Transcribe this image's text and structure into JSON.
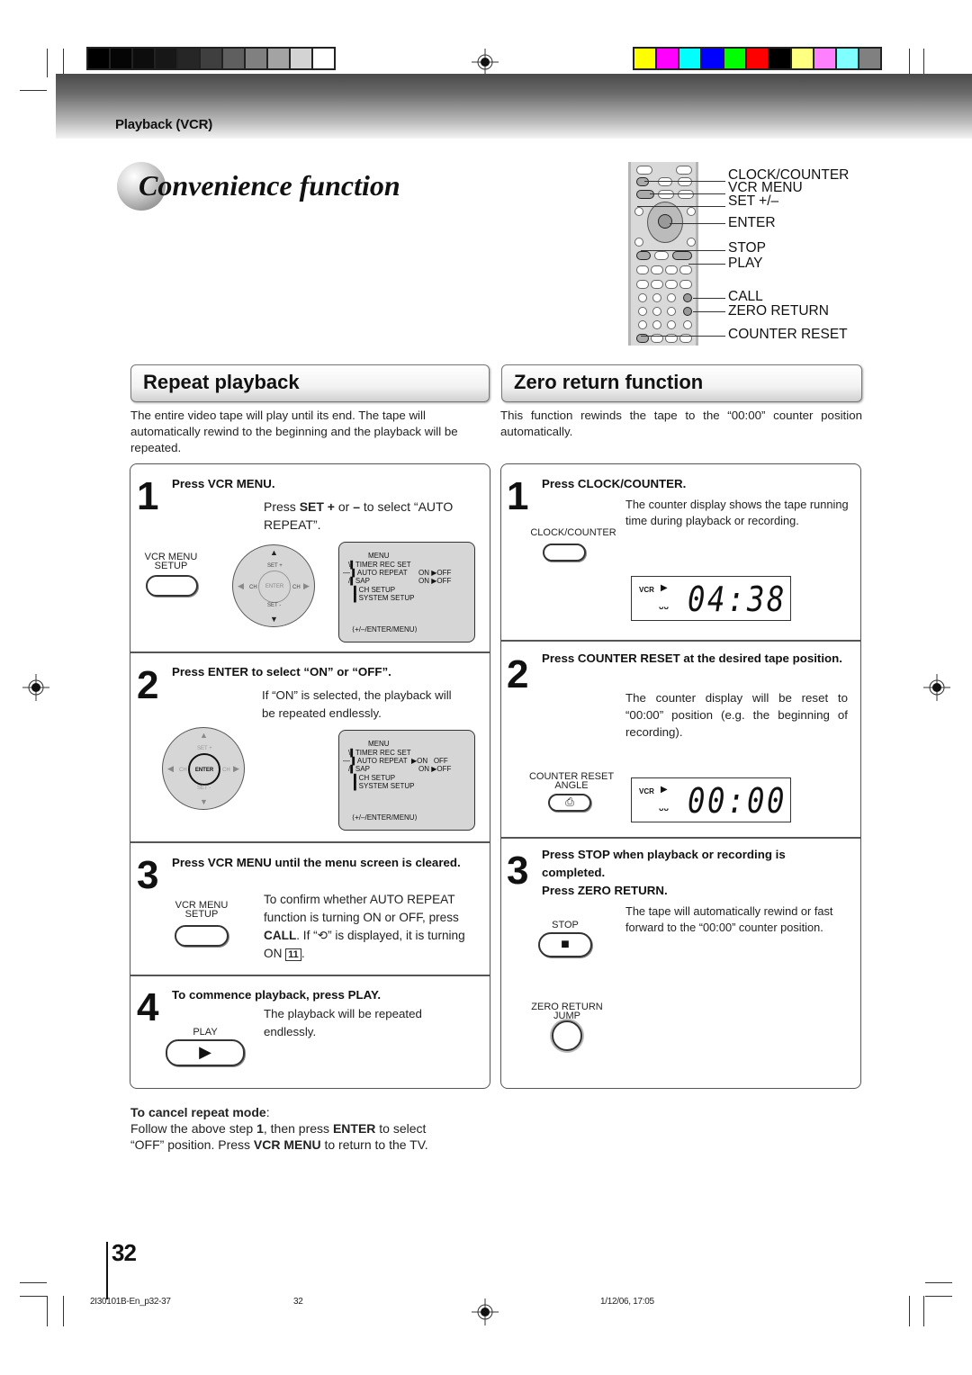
{
  "print_marks": {
    "gray_swatches": [
      "#000000",
      "#050505",
      "#0d0d0d",
      "#171717",
      "#262626",
      "#3f3f3f",
      "#5f5f5f",
      "#808080",
      "#a3a3a3",
      "#d3d3d3",
      "#ffffff"
    ],
    "color_swatches": [
      "#ffff00",
      "#ff00ff",
      "#00ffff",
      "#0000ff",
      "#00ff00",
      "#ff0000",
      "#000000",
      "#ffff80",
      "#ff80ff",
      "#80ffff",
      "#808080"
    ]
  },
  "header": {
    "section_label": "Playback (VCR)",
    "title": "Convenience function"
  },
  "remote": {
    "labels": [
      "CLOCK/COUNTER",
      "VCR MENU",
      "SET +/–",
      "ENTER",
      "STOP",
      "PLAY",
      "CALL",
      "ZERO RETURN",
      "COUNTER RESET"
    ]
  },
  "repeat": {
    "heading": "Repeat playback",
    "intro": "The entire video tape will play until its end. The tape will automatically rewind to the beginning and the playback will be repeated.",
    "steps": [
      {
        "num": "1",
        "head": "Press VCR MENU.",
        "text_pre": "Press ",
        "text_bold1": "SET +",
        "text_mid": " or ",
        "text_bold2": "–",
        "text_post": " to select “AUTO REPEAT”.",
        "button_label_1": "VCR MENU",
        "button_label_2": "SETUP"
      },
      {
        "num": "2",
        "head": "Press ENTER to select “ON” or “OFF”.",
        "text": "If “ON” is selected, the playback will be repeated endlessly."
      },
      {
        "num": "3",
        "head": "Press VCR MENU until the menu screen is cleared.",
        "text_pre": "To confirm whether AUTO REPEAT function is turning ON or OFF, press ",
        "text_bold": "CALL",
        "text_mid": ". If “",
        "text_icon": "⟲",
        "text_post": "” is displayed, it is turning ON ",
        "ref": "11",
        "ref_end": ".",
        "button_label_1": "VCR MENU",
        "button_label_2": "SETUP"
      },
      {
        "num": "4",
        "head": "To commence playback, press PLAY.",
        "text": "The playback will be repeated endlessly.",
        "button_label": "PLAY"
      }
    ],
    "dpad": {
      "set_plus": "SET +",
      "set_minus": "SET -",
      "ch_left": "CH",
      "ch_right": "CH",
      "enter": "ENTER"
    },
    "osd": {
      "title": "MENU",
      "items": [
        "TIMER REC SET",
        "AUTO REPEAT",
        "SAP",
        "CH SETUP",
        "SYSTEM SETUP"
      ],
      "auto_repeat_step1": "ON ▶OFF",
      "auto_repeat_step2": "▶ON   OFF",
      "sap_value": "ON ▶OFF",
      "footer": "⟨+/–/ENTER/MENU⟩"
    },
    "cancel": {
      "title": "To cancel repeat mode",
      "colon": ":",
      "line1_pre": "Follow the above step ",
      "line1_b1": "1",
      "line1_mid": ", then press ",
      "line1_b2": "ENTER",
      "line1_post": " to select",
      "line2_pre": "“OFF” position. Press ",
      "line2_b": "VCR MENU",
      "line2_post": " to return to the TV."
    }
  },
  "zero": {
    "heading": "Zero return function",
    "intro": "This function rewinds the tape to the “00:00” counter position automatically.",
    "steps": [
      {
        "num": "1",
        "head": "Press CLOCK/COUNTER.",
        "text": "The counter display shows the tape running time during playback or recording.",
        "button_label": "CLOCK/COUNTER",
        "lcd": {
          "mode": "VCR",
          "state": "▶",
          "tape": "ᴗᴗ",
          "time": "04:38"
        }
      },
      {
        "num": "2",
        "head": "Press COUNTER RESET at the desired tape position.",
        "text": "The counter display will be reset to “00:00” position (e.g. the beginning of recording).",
        "button_label_1": "COUNTER RESET",
        "button_label_2": "ANGLE",
        "lcd": {
          "mode": "VCR",
          "state": "▶",
          "tape": "ᴗᴗ",
          "time": "00:00"
        }
      },
      {
        "num": "3",
        "head_line1": "Press STOP when playback or recording is",
        "head_line2": "completed.",
        "head_line3": "Press ZERO RETURN.",
        "text": "The tape will automatically rewind or fast forward to the “00:00” counter position.",
        "stop_label": "STOP",
        "zero_label_1": "ZERO RETURN",
        "zero_label_2": "JUMP"
      }
    ]
  },
  "footer": {
    "page_number": "32",
    "file": "2I30101B-En_p32-37",
    "page": "32",
    "date": "1/12/06, 17:05"
  }
}
